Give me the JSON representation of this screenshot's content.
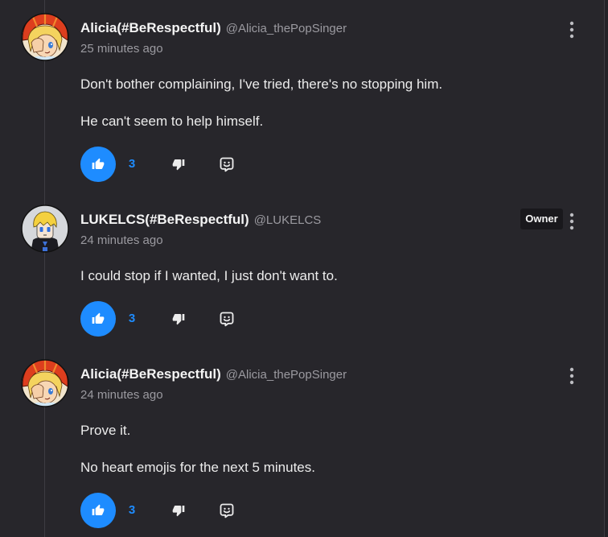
{
  "colors": {
    "background": "#27262b",
    "text": "#ececec",
    "muted": "#9b9aa0",
    "accent": "#1e8cff",
    "thread_line": "#3d3c42",
    "badge_bg": "#19181c"
  },
  "icons": {
    "like": "thumbs-up-icon",
    "dislike": "thumbs-down-icon",
    "reply": "reply-icon",
    "more": "more-vertical-icon"
  },
  "comments": [
    {
      "author": "Alicia(#BeRespectful)",
      "handle": "@Alicia_thePopSinger",
      "time": "25 minutes ago",
      "paragraphs": [
        "Don't bother complaining, I've tried, there's no stopping him.",
        "He can't seem to help himself."
      ],
      "likes": 3,
      "liked": true
    },
    {
      "author": "LUKELCS(#BeRespectful)",
      "handle": "@LUKELCS",
      "badge": "Owner",
      "time": "24 minutes ago",
      "paragraphs": [
        "I could stop if I wanted, I just don't want to."
      ],
      "likes": 3,
      "liked": true
    },
    {
      "author": "Alicia(#BeRespectful)",
      "handle": "@Alicia_thePopSinger",
      "time": "24 minutes ago",
      "paragraphs": [
        "Prove it.",
        "No heart emojis for the next 5 minutes."
      ],
      "likes": 3,
      "liked": true
    }
  ]
}
